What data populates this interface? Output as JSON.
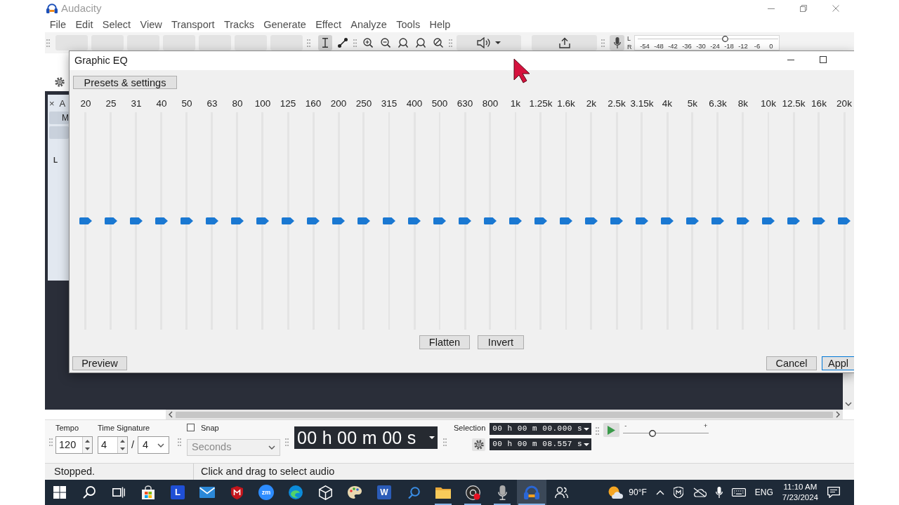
{
  "app_window": {
    "title": "Audacity"
  },
  "menu_bar": [
    "File",
    "Edit",
    "Select",
    "View",
    "Transport",
    "Tracks",
    "Generate",
    "Effect",
    "Analyze",
    "Tools",
    "Help"
  ],
  "tools": [
    {
      "kind": "select",
      "selected": true
    },
    {
      "kind": "envelope",
      "selected": false
    }
  ],
  "recording_meter": {
    "channels": [
      "L",
      "R"
    ],
    "ticks": [
      "-54",
      "-48",
      "-42",
      "-36",
      "-30",
      "-24",
      "-18",
      "-12",
      "-6",
      "0"
    ],
    "level": 0.63
  },
  "track": {
    "close": "×",
    "name": "A",
    "mute": "M",
    "channel": "L"
  },
  "dialog": {
    "title": "Graphic EQ",
    "presets_button": "Presets & settings",
    "bands": [
      {
        "label": "20",
        "level": 0.5
      },
      {
        "label": "25",
        "level": 0.5
      },
      {
        "label": "31",
        "level": 0.5
      },
      {
        "label": "40",
        "level": 0.5
      },
      {
        "label": "50",
        "level": 0.5
      },
      {
        "label": "63",
        "level": 0.5
      },
      {
        "label": "80",
        "level": 0.5
      },
      {
        "label": "100",
        "level": 0.5
      },
      {
        "label": "125",
        "level": 0.5
      },
      {
        "label": "160",
        "level": 0.5
      },
      {
        "label": "200",
        "level": 0.5
      },
      {
        "label": "250",
        "level": 0.5
      },
      {
        "label": "315",
        "level": 0.5
      },
      {
        "label": "400",
        "level": 0.5
      },
      {
        "label": "500",
        "level": 0.5
      },
      {
        "label": "630",
        "level": 0.5
      },
      {
        "label": "800",
        "level": 0.5
      },
      {
        "label": "1k",
        "level": 0.5
      },
      {
        "label": "1.25k",
        "level": 0.5
      },
      {
        "label": "1.6k",
        "level": 0.5
      },
      {
        "label": "2k",
        "level": 0.5
      },
      {
        "label": "2.5k",
        "level": 0.5
      },
      {
        "label": "3.15k",
        "level": 0.5
      },
      {
        "label": "4k",
        "level": 0.5
      },
      {
        "label": "5k",
        "level": 0.5
      },
      {
        "label": "6.3k",
        "level": 0.5
      },
      {
        "label": "8k",
        "level": 0.5
      },
      {
        "label": "10k",
        "level": 0.5
      },
      {
        "label": "12.5k",
        "level": 0.5
      },
      {
        "label": "16k",
        "level": 0.5
      },
      {
        "label": "20k",
        "level": 0.5
      }
    ],
    "flatten_button": "Flatten",
    "invert_button": "Invert",
    "preview_button": "Preview",
    "cancel_button": "Cancel",
    "apply_button": "Appl"
  },
  "tempo": {
    "label": "Tempo",
    "value": "120"
  },
  "time_signature": {
    "label": "Time Signature",
    "upper": "4",
    "separator": "/",
    "lower": "4"
  },
  "snap": {
    "label": "Snap",
    "checked": false,
    "unit": "Seconds",
    "unit_disabled": true
  },
  "time_display": {
    "value": "00 h 00 m 00 s"
  },
  "selection": {
    "label": "Selection",
    "start": "00 h 00 m 00.000 s",
    "end": "00 h 00 m 08.557 s"
  },
  "play_at_speed": {
    "min": "-",
    "max": "+",
    "level": 0.33
  },
  "status_bar": {
    "state": "Stopped.",
    "hint": "Click and drag to select audio"
  },
  "taskbar": {
    "apps": [
      {
        "kind": "windows",
        "running": false,
        "selected": false
      },
      {
        "kind": "search",
        "running": false,
        "selected": false
      },
      {
        "kind": "task-view",
        "running": false,
        "selected": false
      },
      {
        "kind": "store",
        "running": false,
        "selected": false
      },
      {
        "kind": "tile",
        "glyph": "L",
        "running": false,
        "selected": false
      },
      {
        "kind": "mail",
        "running": false,
        "selected": false
      },
      {
        "kind": "shield",
        "running": false,
        "selected": false
      },
      {
        "kind": "circle",
        "glyph": "zm",
        "running": false,
        "selected": false
      },
      {
        "kind": "browser",
        "running": false,
        "selected": false
      },
      {
        "kind": "cube",
        "running": false,
        "selected": false
      },
      {
        "kind": "palette",
        "running": false,
        "selected": false
      },
      {
        "kind": "document",
        "glyph": "W",
        "running": false,
        "selected": false
      },
      {
        "kind": "magnifier",
        "running": false,
        "selected": false
      },
      {
        "kind": "folder",
        "running": true,
        "selected": false
      },
      {
        "kind": "record",
        "running": true,
        "selected": false
      },
      {
        "kind": "microphone",
        "running": true,
        "selected": false
      },
      {
        "kind": "headphones",
        "running": true,
        "selected": true
      },
      {
        "kind": "people",
        "running": false,
        "selected": false
      }
    ],
    "weather": "90°F",
    "language": "ENG",
    "time": "11:10 AM",
    "date": "7/23/2024"
  }
}
